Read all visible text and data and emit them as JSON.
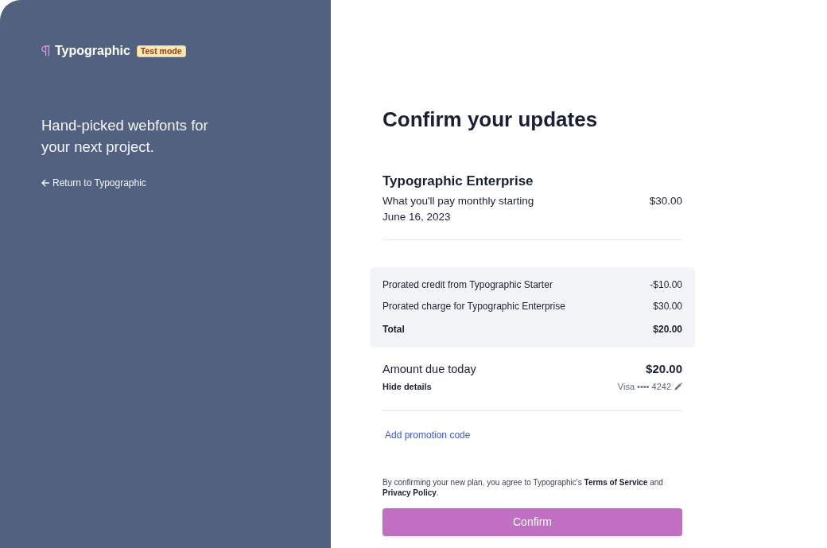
{
  "brand": {
    "name": "Typographic",
    "badge": "Test mode"
  },
  "tagline": "Hand-picked webfonts for your next project.",
  "back_link": "Return to Typographic",
  "title": "Confirm your updates",
  "plan": {
    "name": "Typographic Enterprise",
    "description": "What you'll pay monthly starting June 16, 2023",
    "price": "$30.00"
  },
  "summary": {
    "rows": [
      {
        "kind": "line",
        "label": "Prorated credit from Typographic Starter",
        "amount": "-$10.00"
      },
      {
        "kind": "line",
        "label": "Prorated charge for Typographic Enterprise",
        "amount": "$30.00"
      },
      {
        "kind": "total",
        "label": "Total",
        "amount": "$20.00"
      }
    ]
  },
  "amount_due": {
    "label": "Amount due today",
    "amount": "$20.00",
    "details_toggle": "Hide details",
    "payment_method": "Visa •••• 4242"
  },
  "promo_link": "Add promotion code",
  "legal": [
    {
      "kind": "text",
      "text": "By confirming your new plan, you agree to Typographic's "
    },
    {
      "kind": "link",
      "text": "Terms of Service"
    },
    {
      "kind": "text",
      "text": " and "
    },
    {
      "kind": "link",
      "text": "Privacy Policy"
    },
    {
      "kind": "text",
      "text": "."
    }
  ],
  "confirm_button": "Confirm"
}
